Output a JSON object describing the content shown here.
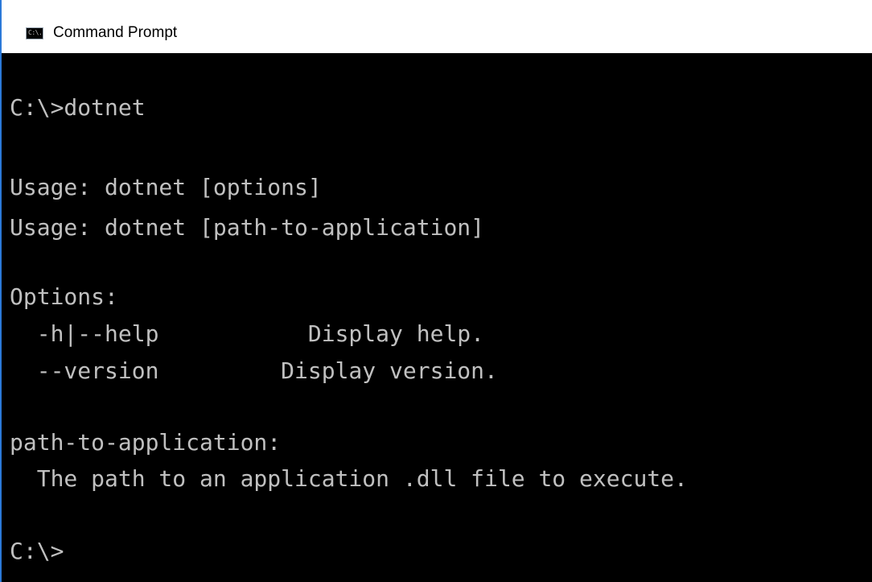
{
  "window": {
    "title": "Command Prompt",
    "icon": "command-prompt-icon",
    "icon_text": "C:\\."
  },
  "console": {
    "lines": [
      "C:\\>dotnet",
      "Usage: dotnet [options]",
      "Usage: dotnet [path-to-application]",
      "Options:",
      "  -h|--help           Display help.",
      "  --version         Display version.",
      "path-to-application:",
      "  The path to an application .dll file to execute.",
      "C:\\>"
    ]
  },
  "colors": {
    "background": "#000000",
    "text": "#c0c0c0",
    "titlebar": "#ffffff",
    "border_accent": "#2b79d8"
  }
}
